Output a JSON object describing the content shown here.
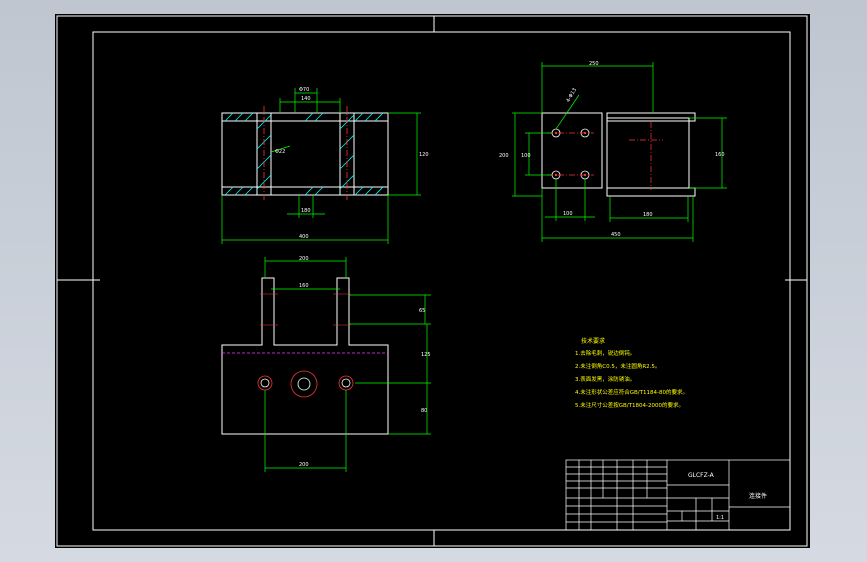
{
  "drawing": {
    "part_code": "GLCFZ-A",
    "part_name": "连接件",
    "tech_title": "技术要求",
    "tech_reqs": [
      "1.去除毛刺，锐边倒钝。",
      "2.未注倒角C0.5，未注圆角R2.5。",
      "3.表面发黑，涂防锈油。",
      "4.未注形状公差应符合GB/T1184-80的要求。",
      "5.未注尺寸公差按GB/T1804-2000的要求。"
    ],
    "scale_label": "1:1"
  },
  "dims": {
    "front_top_a": "Φ70",
    "front_top_b": "140",
    "front_left": "Φ22",
    "front_right": "120",
    "front_bottom_inner": "180",
    "front_bottom_total": "400",
    "side_top": "250",
    "side_dia": "4-Φ13",
    "side_left_a": "200",
    "side_left_b": "100",
    "side_bottom_a": "100",
    "side_bottom_b": "180",
    "side_bottom_total": "450",
    "side_right": "160",
    "top_top": "200",
    "top_inner": "160",
    "top_right_a": "65",
    "top_right_b": "125",
    "top_right_c": "80",
    "top_bottom": "200"
  },
  "colors": {
    "background": "#000000",
    "outline": "#ffffff",
    "dimension": "#00ff00",
    "hatch": "#00ffff",
    "center": "#ff3333",
    "hidden": "#ff33ff",
    "text": "#ffff00"
  }
}
